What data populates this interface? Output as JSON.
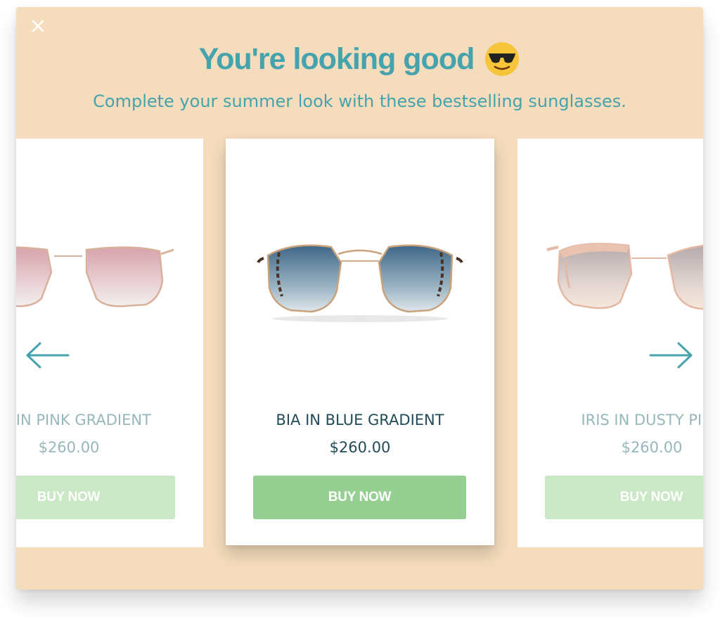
{
  "modal": {
    "title": "You're looking good",
    "emoji": "😎",
    "subtitle": "Complete your summer look with these bestselling sunglasses."
  },
  "products": [
    {
      "name": "BIA IN PINK GRADIENT",
      "price": "$260.00",
      "button": "BUY NOW"
    },
    {
      "name": "BIA IN BLUE GRADIENT",
      "price": "$260.00",
      "button": "BUY NOW"
    },
    {
      "name": "IRIS IN DUSTY PINK",
      "price": "$260.00",
      "button": "BUY NOW"
    }
  ],
  "colors": {
    "background": "#f4dcbc",
    "accent": "#45a3ad",
    "buy_active": "#95d092",
    "buy_faded": "#cbe8c6"
  },
  "icons": {
    "close": "close-icon",
    "prev": "arrow-left-icon",
    "next": "arrow-right-icon"
  }
}
